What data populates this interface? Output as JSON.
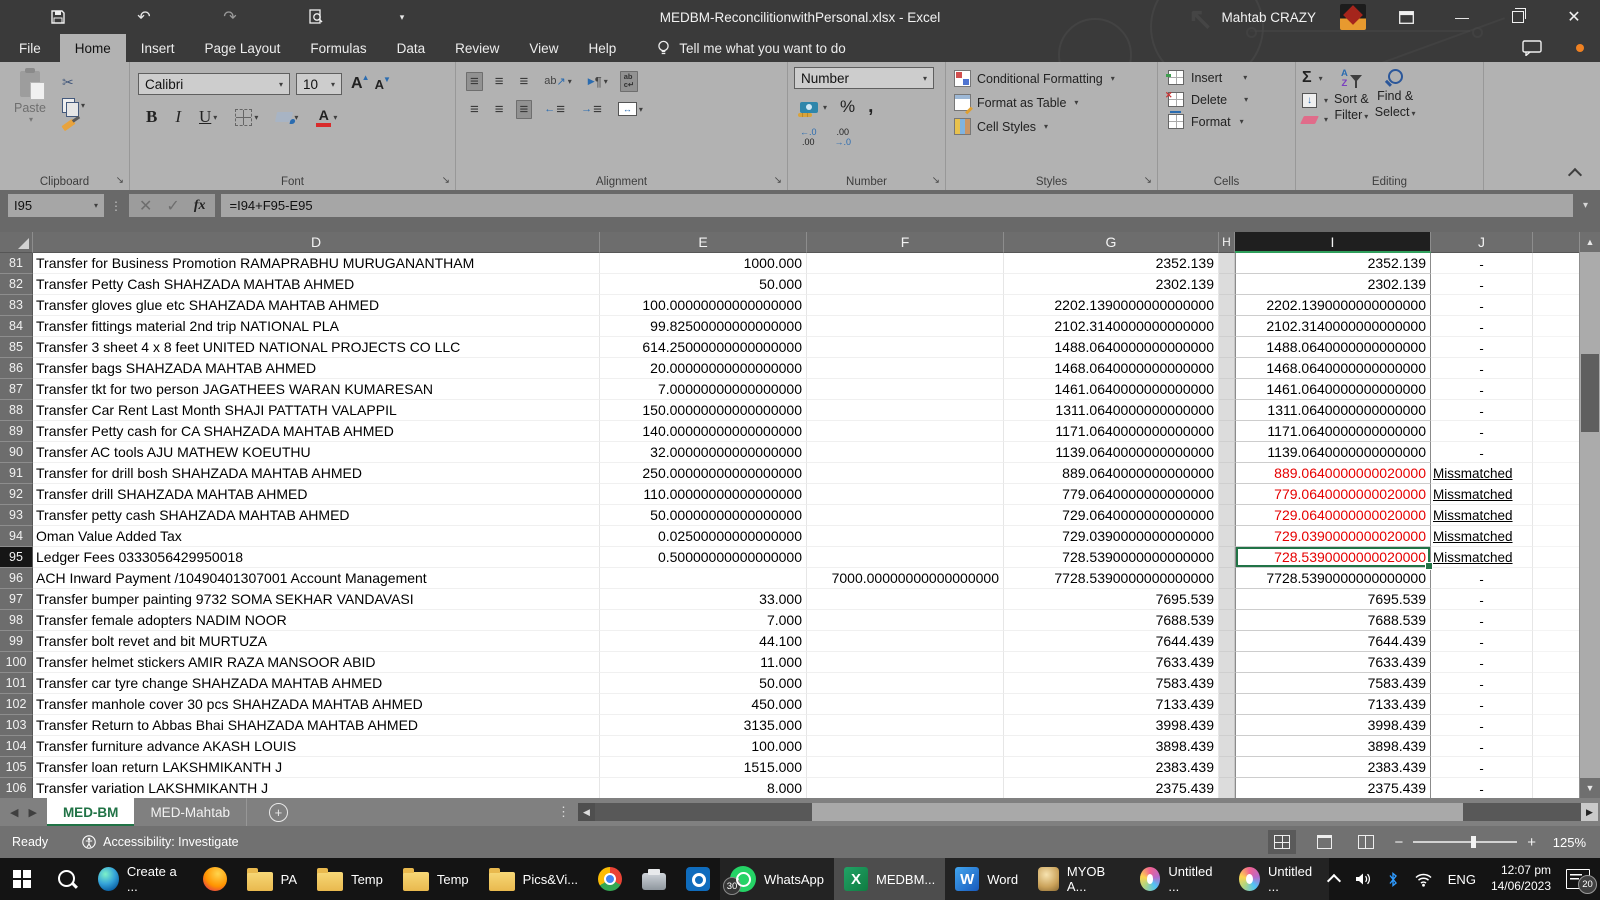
{
  "titlebar": {
    "title": "MEDBM-ReconcilitionwithPersonal.xlsx  -  Excel",
    "user": "Mahtab CRAZY"
  },
  "menu": {
    "items": [
      "File",
      "Home",
      "Insert",
      "Page Layout",
      "Formulas",
      "Data",
      "Review",
      "View",
      "Help"
    ],
    "active": "Home",
    "tell_me": "Tell me what you want to do"
  },
  "ribbon": {
    "clipboard": {
      "label": "Clipboard",
      "paste": "Paste"
    },
    "font": {
      "label": "Font",
      "family": "Calibri",
      "size": "10",
      "bold": "B",
      "italic": "I",
      "underline": "U"
    },
    "alignment": {
      "label": "Alignment"
    },
    "number": {
      "label": "Number",
      "format": "Number",
      "percent": "%",
      "comma": ",",
      "inc_top": "←.0",
      "inc_bot": ".00",
      "dec_top": ".00",
      "dec_bot": "→.0"
    },
    "styles": {
      "label": "Styles",
      "conditional": "Conditional Formatting",
      "format_table": "Format as Table",
      "cell_styles": "Cell Styles"
    },
    "cells": {
      "label": "Cells",
      "insert": "Insert",
      "delete": "Delete",
      "format": "Format"
    },
    "editing": {
      "label": "Editing",
      "autosum": "Σ",
      "sort_line1": "Sort &",
      "sort_line2": "Filter",
      "find_line1": "Find &",
      "find_line2": "Select"
    }
  },
  "formula_bar": {
    "name_box": "I95",
    "fx": "fx",
    "formula": "=I94+F95-E95"
  },
  "grid": {
    "columns": [
      "D",
      "E",
      "F",
      "G",
      "H",
      "I",
      "J"
    ],
    "selected_column": "I",
    "selected_cell": "I95",
    "rows": [
      {
        "n": "81",
        "d": "Transfer for Business Promotion RAMAPRABHU MURUGANANTHAM",
        "e": "1000.000",
        "f": "",
        "g": "2352.139",
        "i": "2352.139",
        "j": "-",
        "mm": false,
        "sel": false
      },
      {
        "n": "82",
        "d": "Transfer Petty Cash SHAHZADA MAHTAB AHMED",
        "e": "50.000",
        "f": "",
        "g": "2302.139",
        "i": "2302.139",
        "j": "-",
        "mm": false,
        "sel": false
      },
      {
        "n": "83",
        "d": "Transfer gloves glue etc SHAHZADA MAHTAB AHMED",
        "e": "100.00000000000000000",
        "f": "",
        "g": "2202.1390000000000000",
        "i": "2202.1390000000000000",
        "j": "-",
        "mm": false,
        "sel": false
      },
      {
        "n": "84",
        "d": "Transfer fittings material 2nd trip NATIONAL PLA",
        "e": "99.82500000000000000",
        "f": "",
        "g": "2102.3140000000000000",
        "i": "2102.3140000000000000",
        "j": "-",
        "mm": false,
        "sel": false
      },
      {
        "n": "85",
        "d": "Transfer 3 sheet 4 x 8 feet UNITED NATIONAL PROJECTS CO LLC",
        "e": "614.25000000000000000",
        "f": "",
        "g": "1488.0640000000000000",
        "i": "1488.0640000000000000",
        "j": "-",
        "mm": false,
        "sel": false
      },
      {
        "n": "86",
        "d": "Transfer bags SHAHZADA MAHTAB AHMED",
        "e": "20.00000000000000000",
        "f": "",
        "g": "1468.0640000000000000",
        "i": "1468.0640000000000000",
        "j": "-",
        "mm": false,
        "sel": false
      },
      {
        "n": "87",
        "d": "Transfer tkt for two person JAGATHEES WARAN KUMARESAN",
        "e": "7.00000000000000000",
        "f": "",
        "g": "1461.0640000000000000",
        "i": "1461.0640000000000000",
        "j": "-",
        "mm": false,
        "sel": false
      },
      {
        "n": "88",
        "d": "Transfer Car Rent Last Month SHAJI PATTATH VALAPPIL",
        "e": "150.00000000000000000",
        "f": "",
        "g": "1311.0640000000000000",
        "i": "1311.0640000000000000",
        "j": "-",
        "mm": false,
        "sel": false
      },
      {
        "n": "89",
        "d": "Transfer Petty cash for CA SHAHZADA MAHTAB AHMED",
        "e": "140.00000000000000000",
        "f": "",
        "g": "1171.0640000000000000",
        "i": "1171.0640000000000000",
        "j": "-",
        "mm": false,
        "sel": false
      },
      {
        "n": "90",
        "d": "Transfer AC tools AJU MATHEW KOEUTHU",
        "e": "32.00000000000000000",
        "f": "",
        "g": "1139.0640000000000000",
        "i": "1139.0640000000000000",
        "j": "-",
        "mm": false,
        "sel": false
      },
      {
        "n": "91",
        "d": "Transfer for drill bosh SHAHZADA MAHTAB AHMED",
        "e": "250.00000000000000000",
        "f": "",
        "g": "889.0640000000000000",
        "i": "889.0640000000020000",
        "j": "Missmatched",
        "mm": true,
        "sel": false
      },
      {
        "n": "92",
        "d": "Transfer drill SHAHZADA MAHTAB AHMED",
        "e": "110.00000000000000000",
        "f": "",
        "g": "779.0640000000000000",
        "i": "779.0640000000020000",
        "j": "Missmatched",
        "mm": true,
        "sel": false
      },
      {
        "n": "93",
        "d": "Transfer petty cash SHAHZADA MAHTAB AHMED",
        "e": "50.00000000000000000",
        "f": "",
        "g": "729.0640000000000000",
        "i": "729.0640000000020000",
        "j": "Missmatched",
        "mm": true,
        "sel": false
      },
      {
        "n": "94",
        "d": "Oman Value Added Tax",
        "e": "0.02500000000000000",
        "f": "",
        "g": "729.0390000000000000",
        "i": "729.0390000000020000",
        "j": "Missmatched",
        "mm": true,
        "sel": false
      },
      {
        "n": "95",
        "d": "Ledger Fees 0333056429950018",
        "e": "0.50000000000000000",
        "f": "",
        "g": "728.5390000000000000",
        "i": "728.5390000000020000",
        "j": "Missmatched",
        "mm": true,
        "sel": true
      },
      {
        "n": "96",
        "d": "ACH Inward Payment /10490401307001 Account Management",
        "e": "",
        "f": "7000.00000000000000000",
        "g": "7728.5390000000000000",
        "i": "7728.5390000000000000",
        "j": "-",
        "mm": false,
        "sel": false
      },
      {
        "n": "97",
        "d": "Transfer bumper painting 9732 SOMA SEKHAR VANDAVASI",
        "e": "33.000",
        "f": "",
        "g": "7695.539",
        "i": "7695.539",
        "j": "-",
        "mm": false,
        "sel": false
      },
      {
        "n": "98",
        "d": "Transfer female adopters NADIM NOOR",
        "e": "7.000",
        "f": "",
        "g": "7688.539",
        "i": "7688.539",
        "j": "-",
        "mm": false,
        "sel": false
      },
      {
        "n": "99",
        "d": "Transfer bolt revet and bit MURTUZA",
        "e": "44.100",
        "f": "",
        "g": "7644.439",
        "i": "7644.439",
        "j": "-",
        "mm": false,
        "sel": false
      },
      {
        "n": "100",
        "d": "Transfer helmet stickers AMIR RAZA MANSOOR ABID",
        "e": "11.000",
        "f": "",
        "g": "7633.439",
        "i": "7633.439",
        "j": "-",
        "mm": false,
        "sel": false
      },
      {
        "n": "101",
        "d": "Transfer car tyre change SHAHZADA MAHTAB AHMED",
        "e": "50.000",
        "f": "",
        "g": "7583.439",
        "i": "7583.439",
        "j": "-",
        "mm": false,
        "sel": false
      },
      {
        "n": "102",
        "d": "Transfer manhole cover 30 pcs SHAHZADA MAHTAB AHMED",
        "e": "450.000",
        "f": "",
        "g": "7133.439",
        "i": "7133.439",
        "j": "-",
        "mm": false,
        "sel": false
      },
      {
        "n": "103",
        "d": "Transfer Return to Abbas Bhai SHAHZADA MAHTAB AHMED",
        "e": "3135.000",
        "f": "",
        "g": "3998.439",
        "i": "3998.439",
        "j": "-",
        "mm": false,
        "sel": false
      },
      {
        "n": "104",
        "d": "Transfer furniture advance AKASH LOUIS",
        "e": "100.000",
        "f": "",
        "g": "3898.439",
        "i": "3898.439",
        "j": "-",
        "mm": false,
        "sel": false
      },
      {
        "n": "105",
        "d": "Transfer loan return LAKSHMIKANTH J",
        "e": "1515.000",
        "f": "",
        "g": "2383.439",
        "i": "2383.439",
        "j": "-",
        "mm": false,
        "sel": false
      },
      {
        "n": "106",
        "d": "Transfer variation LAKSHMIKANTH J",
        "e": "8.000",
        "f": "",
        "g": "2375.439",
        "i": "2375.439",
        "j": "-",
        "mm": false,
        "sel": false
      }
    ]
  },
  "sheet_bar": {
    "tabs": [
      {
        "label": "MED-BM",
        "active": true
      },
      {
        "label": "MED-Mahtab",
        "active": false
      }
    ]
  },
  "status_bar": {
    "mode": "Ready",
    "accessibility": "Accessibility: Investigate",
    "zoom_level": "125%"
  },
  "taskbar": {
    "apps": [
      {
        "icon": "start",
        "label": ""
      },
      {
        "icon": "search",
        "label": ""
      },
      {
        "icon": "edge",
        "label": "Create a ..."
      },
      {
        "icon": "firefox",
        "label": ""
      },
      {
        "icon": "folder",
        "label": "PA"
      },
      {
        "icon": "folder",
        "label": "Temp"
      },
      {
        "icon": "folder",
        "label": "Temp"
      },
      {
        "icon": "folder",
        "label": "Pics&Vi..."
      },
      {
        "icon": "chrome",
        "label": ""
      },
      {
        "icon": "printer",
        "label": ""
      },
      {
        "icon": "outlook",
        "label": ""
      },
      {
        "icon": "whatsapp",
        "label": "WhatsApp",
        "badge": "30",
        "open": true
      },
      {
        "icon": "excel",
        "label": "MEDBM...",
        "active": true
      },
      {
        "icon": "word",
        "label": "Word",
        "open": true
      },
      {
        "icon": "myob",
        "label": "MYOB A...",
        "open": true
      },
      {
        "icon": "paint",
        "label": "Untitled ...",
        "open": true
      },
      {
        "icon": "paint",
        "label": "Untitled ...",
        "open": true
      }
    ],
    "tray": {
      "lang": "ENG",
      "time": "12:07 pm",
      "date": "14/06/2023",
      "notif_badge": "20"
    }
  }
}
